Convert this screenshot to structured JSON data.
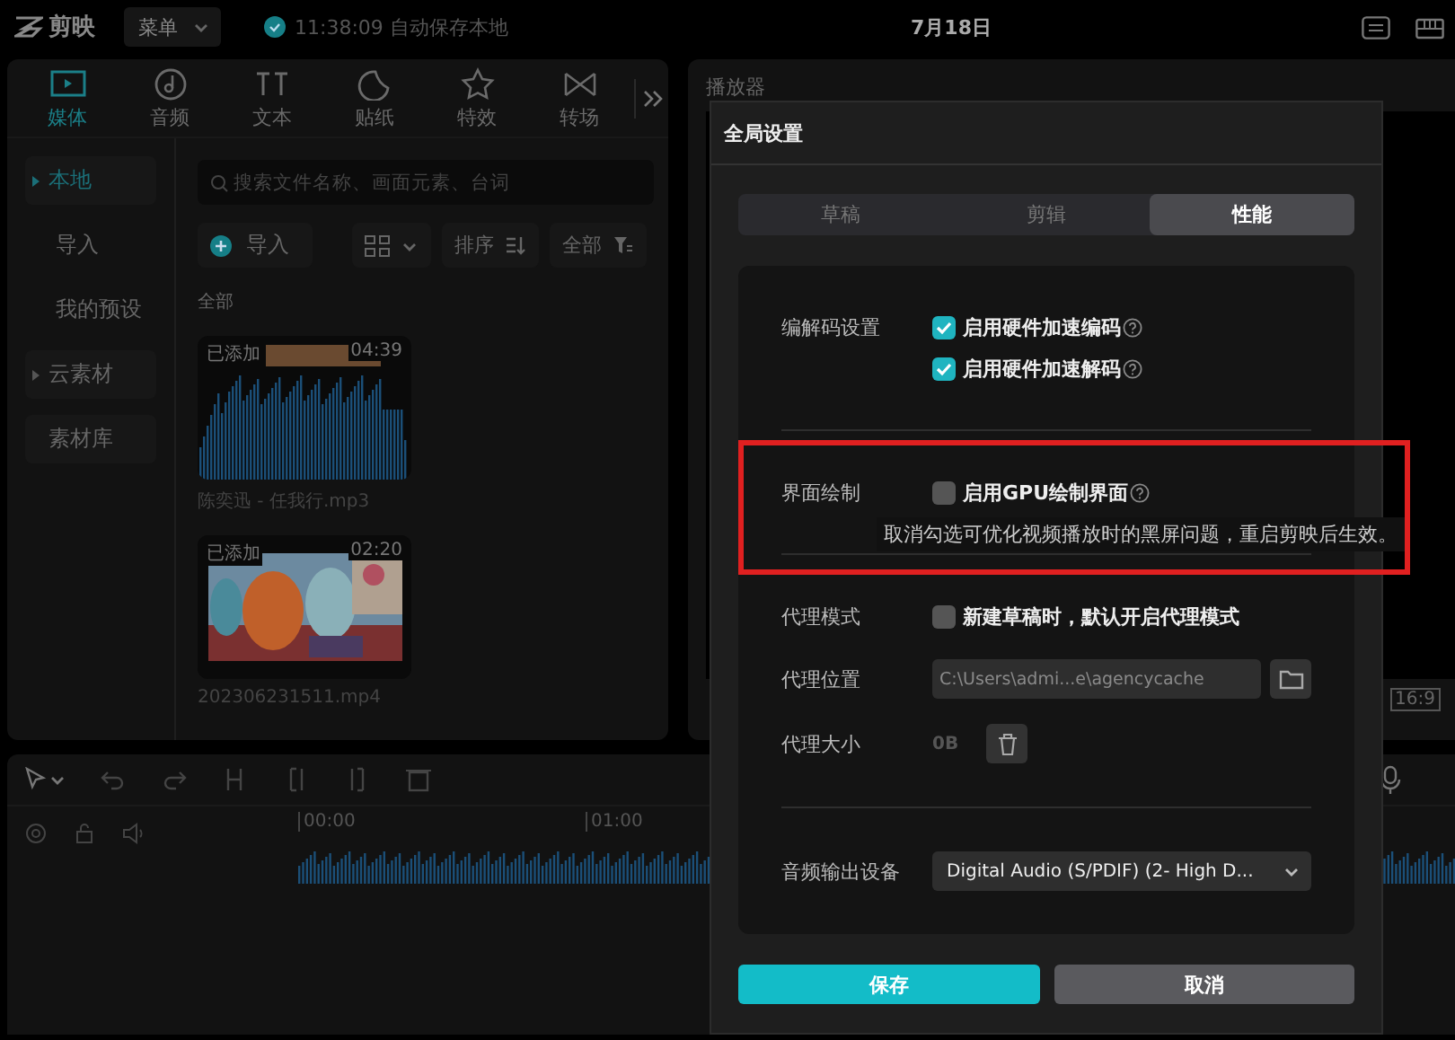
{
  "topbar": {
    "app_name": "剪映",
    "menu": "菜单",
    "save_status": "11:38:09 自动保存本地",
    "title": "7月18日"
  },
  "media_panel": {
    "tabs": [
      {
        "label": "媒体",
        "kind": "media",
        "selected": true
      },
      {
        "label": "音频",
        "kind": "audio",
        "selected": false
      },
      {
        "label": "文本",
        "kind": "text",
        "selected": false
      },
      {
        "label": "贴纸",
        "kind": "sticker",
        "selected": false
      },
      {
        "label": "特效",
        "kind": "effect",
        "selected": false
      },
      {
        "label": "转场",
        "kind": "transition",
        "selected": false
      }
    ],
    "sidebar": [
      {
        "label": "本地",
        "kind": "folder",
        "selected": true
      },
      {
        "label": "导入",
        "kind": "entry",
        "selected": false
      },
      {
        "label": "我的预设",
        "kind": "entry",
        "selected": false
      },
      {
        "label": "云素材",
        "kind": "folder",
        "selected": false
      },
      {
        "label": "素材库",
        "kind": "library",
        "selected": false
      }
    ],
    "search": {
      "placeholder": "搜索文件名称、画面元素、台词"
    },
    "import_button": "导入",
    "sort_button": "排序",
    "filter_button": "全部",
    "section_label": "全部",
    "media": [
      {
        "kind": "audio",
        "badge": "已添加",
        "duration": "04:39",
        "name": "陈奕迅 - 任我行.mp3"
      },
      {
        "kind": "video",
        "badge": "已添加",
        "duration": "02:20",
        "name": "202306231511.mp4"
      }
    ]
  },
  "player": {
    "title": "播放器",
    "aspect": "16:9"
  },
  "timeline": {
    "timecodes": [
      "00:00",
      "01:00"
    ]
  },
  "dialog": {
    "title": "全局设置",
    "tabs": [
      {
        "label": "草稿",
        "selected": false
      },
      {
        "label": "剪辑",
        "selected": false
      },
      {
        "label": "性能",
        "selected": true
      }
    ],
    "groups": [
      {
        "rows": [
          {
            "label": "编解码设置",
            "kind": "checkbox",
            "text": "启用硬件加速编码",
            "checked": true,
            "help": true
          },
          {
            "kind": "checkbox",
            "text": "启用硬件加速解码",
            "checked": true,
            "help": true
          }
        ]
      },
      {
        "rows": [
          {
            "label": "界面绘制",
            "kind": "checkbox",
            "text": "启用GPU绘制界面",
            "checked": false,
            "help": true
          }
        ]
      },
      {
        "rows": [
          {
            "label": "代理模式",
            "kind": "checkbox",
            "text": "新建草稿时，默认开启代理模式",
            "checked": false,
            "help": false
          },
          {
            "label": "代理位置",
            "kind": "path",
            "value": "C:\\Users\\admi...e\\agencycache"
          },
          {
            "label": "代理大小",
            "kind": "size",
            "value": "0B"
          }
        ]
      },
      {
        "rows": [
          {
            "label": "音频输出设备",
            "kind": "select",
            "value": "Digital Audio (S/PDIF) (2- High D..."
          }
        ]
      }
    ],
    "tooltip": "取消勾选可优化视频播放时的黑屏问题，重启剪映后生效。",
    "buttons": [
      {
        "label": "保存",
        "kind": "primary"
      },
      {
        "label": "取消",
        "kind": "secondary"
      }
    ],
    "highlight_box": true
  }
}
